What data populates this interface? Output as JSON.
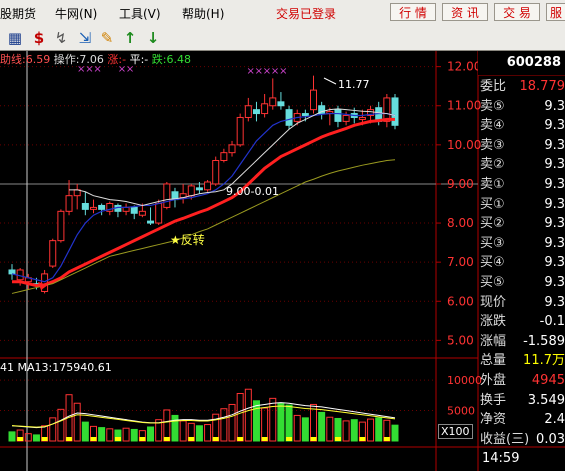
{
  "menu": {
    "items": [
      {
        "label": "股期货"
      },
      {
        "label": "牛网(N)"
      },
      {
        "label": "工具(V)"
      },
      {
        "label": "帮助(H)"
      }
    ],
    "login_status": "交易已登录",
    "buttons": [
      {
        "label": "行 情"
      },
      {
        "label": "资 讯"
      },
      {
        "label": "交 易"
      },
      {
        "label": "服"
      }
    ]
  },
  "toolbar": {
    "icons": [
      "grid-icon",
      "dollar-icon",
      "link-icon",
      "export-icon",
      "pencil-icon",
      "up-arrow-icon",
      "down-arrow-icon"
    ],
    "glyphs": [
      "▦",
      "$",
      "↯",
      "⇲",
      "✎",
      "↑",
      "↓"
    ]
  },
  "indicator_legend": {
    "line1": "助线:6.59",
    "line2": "操作:7.06",
    "line3": "涨:-",
    "line4": "平:-",
    "line5": "跌:6.48"
  },
  "annotations": {
    "high_label": "11.77",
    "mid_label": "9.00-0.01",
    "star_label": "★反转"
  },
  "volume_legend": "41 MA13:175940.61",
  "x100_label": "X100",
  "quote": {
    "code": "600288",
    "rows": [
      {
        "label": "委比",
        "value": "18.779",
        "color": "#ff3333"
      },
      {
        "label": "卖⑤",
        "value": "9.3",
        "color": "#ffffff"
      },
      {
        "label": "卖④",
        "value": "9.3",
        "color": "#ffffff"
      },
      {
        "label": "卖③",
        "value": "9.3",
        "color": "#ffffff"
      },
      {
        "label": "卖②",
        "value": "9.3",
        "color": "#ffffff"
      },
      {
        "label": "卖①",
        "value": "9.3",
        "color": "#ffffff"
      },
      {
        "label": "买①",
        "value": "9.3",
        "color": "#ffffff"
      },
      {
        "label": "买②",
        "value": "9.3",
        "color": "#ffffff"
      },
      {
        "label": "买③",
        "value": "9.3",
        "color": "#ffffff"
      },
      {
        "label": "买④",
        "value": "9.3",
        "color": "#ffffff"
      },
      {
        "label": "买⑤",
        "value": "9.3",
        "color": "#ffffff"
      },
      {
        "label": "现价",
        "value": "9.3",
        "color": "#ffffff"
      },
      {
        "label": "涨跌",
        "value": "-0.1",
        "color": "#ffffff"
      },
      {
        "label": "涨幅",
        "value": "-1.589",
        "color": "#ffffff"
      },
      {
        "label": "总量",
        "value": "11.7万",
        "color": "#ffff00"
      },
      {
        "label": "外盘",
        "value": "4945",
        "color": "#ff3333"
      },
      {
        "label": "换手",
        "value": "3.549",
        "color": "#ffffff"
      },
      {
        "label": "净资",
        "value": "2.4",
        "color": "#ffffff"
      },
      {
        "label": "收益(三)",
        "value": "0.03",
        "color": "#ffffff"
      }
    ],
    "time": "14:59"
  },
  "chart_data": {
    "type": "candlestick",
    "price_axis_ticks": [
      "12.00",
      "11.00",
      "10.00",
      "9.00",
      "8.00",
      "7.00",
      "6.00",
      "5.00"
    ],
    "ylim": [
      4.6,
      12.4
    ],
    "volume_axis_ticks": [
      "10000",
      "5000"
    ],
    "volume_ylim": [
      0,
      11000
    ],
    "candles": [
      {
        "o": 6.8,
        "c": 6.7,
        "h": 6.95,
        "l": 6.55
      },
      {
        "o": 6.55,
        "c": 6.8,
        "h": 6.85,
        "l": 6.4
      },
      {
        "o": 6.5,
        "c": 6.6,
        "h": 6.7,
        "l": 6.3
      },
      {
        "o": 6.45,
        "c": 6.4,
        "h": 6.6,
        "l": 6.3
      },
      {
        "o": 6.25,
        "c": 6.7,
        "h": 6.8,
        "l": 6.2
      },
      {
        "o": 6.9,
        "c": 7.55,
        "h": 7.6,
        "l": 6.85
      },
      {
        "o": 7.55,
        "c": 8.3,
        "h": 8.35,
        "l": 7.5
      },
      {
        "o": 8.3,
        "c": 8.7,
        "h": 9.1,
        "l": 8.2
      },
      {
        "o": 8.7,
        "c": 8.85,
        "h": 9.0,
        "l": 8.35
      },
      {
        "o": 8.5,
        "c": 8.35,
        "h": 8.8,
        "l": 8.2
      },
      {
        "o": 8.35,
        "c": 8.4,
        "h": 8.6,
        "l": 8.25
      },
      {
        "o": 8.45,
        "c": 8.35,
        "h": 8.5,
        "l": 8.2
      },
      {
        "o": 8.3,
        "c": 8.5,
        "h": 8.55,
        "l": 8.2
      },
      {
        "o": 8.45,
        "c": 8.3,
        "h": 8.5,
        "l": 8.15
      },
      {
        "o": 8.3,
        "c": 8.4,
        "h": 8.5,
        "l": 8.2
      },
      {
        "o": 8.4,
        "c": 8.25,
        "h": 8.45,
        "l": 8.1
      },
      {
        "o": 8.2,
        "c": 8.3,
        "h": 8.5,
        "l": 8.15
      },
      {
        "o": 8.05,
        "c": 8.0,
        "h": 8.4,
        "l": 7.95
      },
      {
        "o": 8.0,
        "c": 8.5,
        "h": 8.6,
        "l": 7.95
      },
      {
        "o": 8.4,
        "c": 9.0,
        "h": 9.05,
        "l": 8.35
      },
      {
        "o": 8.8,
        "c": 8.6,
        "h": 8.9,
        "l": 8.4
      },
      {
        "o": 8.65,
        "c": 8.75,
        "h": 9.0,
        "l": 8.5
      },
      {
        "o": 8.7,
        "c": 8.95,
        "h": 9.0,
        "l": 8.6
      },
      {
        "o": 8.9,
        "c": 8.85,
        "h": 9.05,
        "l": 8.75
      },
      {
        "o": 8.85,
        "c": 9.05,
        "h": 9.1,
        "l": 8.8
      },
      {
        "o": 9.0,
        "c": 9.6,
        "h": 9.7,
        "l": 8.95
      },
      {
        "o": 9.6,
        "c": 9.8,
        "h": 9.9,
        "l": 9.55
      },
      {
        "o": 9.8,
        "c": 10.0,
        "h": 10.1,
        "l": 9.7
      },
      {
        "o": 10.0,
        "c": 10.7,
        "h": 10.8,
        "l": 9.95
      },
      {
        "o": 10.7,
        "c": 11.0,
        "h": 11.2,
        "l": 10.6
      },
      {
        "o": 10.9,
        "c": 10.8,
        "h": 11.1,
        "l": 10.6
      },
      {
        "o": 10.8,
        "c": 11.05,
        "h": 11.3,
        "l": 10.7
      },
      {
        "o": 11.0,
        "c": 11.2,
        "h": 11.7,
        "l": 10.9
      },
      {
        "o": 11.1,
        "c": 11.0,
        "h": 11.35,
        "l": 10.9
      },
      {
        "o": 10.9,
        "c": 10.5,
        "h": 11.0,
        "l": 10.4
      },
      {
        "o": 10.6,
        "c": 10.8,
        "h": 10.9,
        "l": 10.5
      },
      {
        "o": 10.8,
        "c": 10.75,
        "h": 10.9,
        "l": 10.6
      },
      {
        "o": 10.9,
        "c": 11.4,
        "h": 11.77,
        "l": 10.8
      },
      {
        "o": 11.0,
        "c": 10.8,
        "h": 11.1,
        "l": 10.65
      },
      {
        "o": 10.8,
        "c": 10.85,
        "h": 10.95,
        "l": 10.5
      },
      {
        "o": 10.9,
        "c": 10.6,
        "h": 11.0,
        "l": 10.45
      },
      {
        "o": 10.6,
        "c": 10.75,
        "h": 10.85,
        "l": 10.5
      },
      {
        "o": 10.8,
        "c": 10.7,
        "h": 10.95,
        "l": 10.55
      },
      {
        "o": 10.65,
        "c": 10.7,
        "h": 10.9,
        "l": 10.5
      },
      {
        "o": 10.75,
        "c": 10.9,
        "h": 11.0,
        "l": 10.55
      },
      {
        "o": 10.95,
        "c": 10.6,
        "h": 11.1,
        "l": 10.5
      },
      {
        "o": 10.6,
        "c": 11.2,
        "h": 11.3,
        "l": 10.45
      },
      {
        "o": 11.2,
        "c": 10.5,
        "h": 11.3,
        "l": 10.4
      }
    ],
    "series": [
      {
        "name": "red",
        "values": [
          6.5,
          6.5,
          6.45,
          6.4,
          6.42,
          6.5,
          6.6,
          6.75,
          6.85,
          6.95,
          7.05,
          7.15,
          7.25,
          7.35,
          7.45,
          7.55,
          7.65,
          7.75,
          7.85,
          7.95,
          8.05,
          8.12,
          8.2,
          8.28,
          8.35,
          8.45,
          8.55,
          8.65,
          8.8,
          9.0,
          9.2,
          9.4,
          9.55,
          9.7,
          9.8,
          9.9,
          10.0,
          10.1,
          10.2,
          10.28,
          10.35,
          10.42,
          10.5,
          10.55,
          10.6,
          10.62,
          10.65,
          10.65
        ]
      },
      {
        "name": "blue",
        "values": [
          6.7,
          6.65,
          6.6,
          6.55,
          6.5,
          6.6,
          6.9,
          7.3,
          7.7,
          8.0,
          8.2,
          8.3,
          8.35,
          8.4,
          8.4,
          8.42,
          8.45,
          8.45,
          8.5,
          8.55,
          8.6,
          8.62,
          8.65,
          8.7,
          8.75,
          8.85,
          9.0,
          9.2,
          9.5,
          9.8,
          10.1,
          10.3,
          10.5,
          10.6,
          10.65,
          10.7,
          10.72,
          10.75,
          10.78,
          10.8,
          10.8,
          10.78,
          10.75,
          10.75,
          10.78,
          10.8,
          10.8,
          10.75
        ]
      },
      {
        "name": "white",
        "values": [
          null,
          null,
          null,
          null,
          null,
          null,
          null,
          8.85,
          8.85,
          8.8,
          8.7,
          8.65,
          8.6,
          8.58,
          8.55,
          8.5,
          8.45,
          8.5,
          8.55,
          8.6,
          8.62,
          8.65,
          8.7,
          8.75,
          8.78,
          8.8,
          8.85,
          9.0,
          9.2,
          9.4,
          9.6,
          9.8,
          10.0,
          10.2,
          10.4,
          10.55,
          10.65,
          10.75,
          10.85,
          10.9,
          10.92,
          10.9,
          10.88,
          10.86,
          10.85,
          10.82,
          10.8,
          10.75
        ]
      },
      {
        "name": "olive",
        "values": [
          6.2,
          6.25,
          6.3,
          6.35,
          6.4,
          6.45,
          6.55,
          6.65,
          6.75,
          6.85,
          6.95,
          7.05,
          7.15,
          7.2,
          7.25,
          7.3,
          7.35,
          7.4,
          7.45,
          7.5,
          7.55,
          7.62,
          7.7,
          7.78,
          7.85,
          7.95,
          8.05,
          8.15,
          8.25,
          8.35,
          8.45,
          8.55,
          8.65,
          8.75,
          8.85,
          8.95,
          9.05,
          9.12,
          9.2,
          9.27,
          9.33,
          9.38,
          9.43,
          9.48,
          9.52,
          9.56,
          9.6,
          9.62
        ]
      }
    ],
    "volumes": [
      1500,
      1800,
      1200,
      1000,
      2500,
      3800,
      5200,
      7600,
      6200,
      3100,
      2400,
      2200,
      2000,
      1800,
      2100,
      1900,
      1700,
      2300,
      3500,
      5100,
      4200,
      3300,
      2900,
      2500,
      2700,
      4400,
      5300,
      6000,
      7800,
      8500,
      6600,
      5400,
      7000,
      6200,
      5900,
      4200,
      3800,
      6000,
      4700,
      3900,
      3700,
      3300,
      3500,
      3100,
      3600,
      3800,
      3400,
      2600
    ],
    "volume_ma": [
      2500,
      2400,
      2300,
      2200,
      2300,
      2800,
      3400,
      4100,
      4600,
      4500,
      4300,
      4100,
      3900,
      3700,
      3500,
      3300,
      3100,
      3000,
      3000,
      3200,
      3400,
      3500,
      3500,
      3400,
      3400,
      3600,
      3900,
      4300,
      4900,
      5400,
      5800,
      6000,
      6200,
      6300,
      6200,
      6000,
      5800,
      5700,
      5600,
      5400,
      5200,
      5000,
      4800,
      4600,
      4400,
      4200,
      4000,
      3800
    ],
    "markers": {
      "x_star_indices": [
        7,
        8,
        9,
        12,
        13
      ],
      "purple_x_indices": [
        30,
        31,
        32,
        33,
        34
      ],
      "star_candle_index": 17
    }
  }
}
